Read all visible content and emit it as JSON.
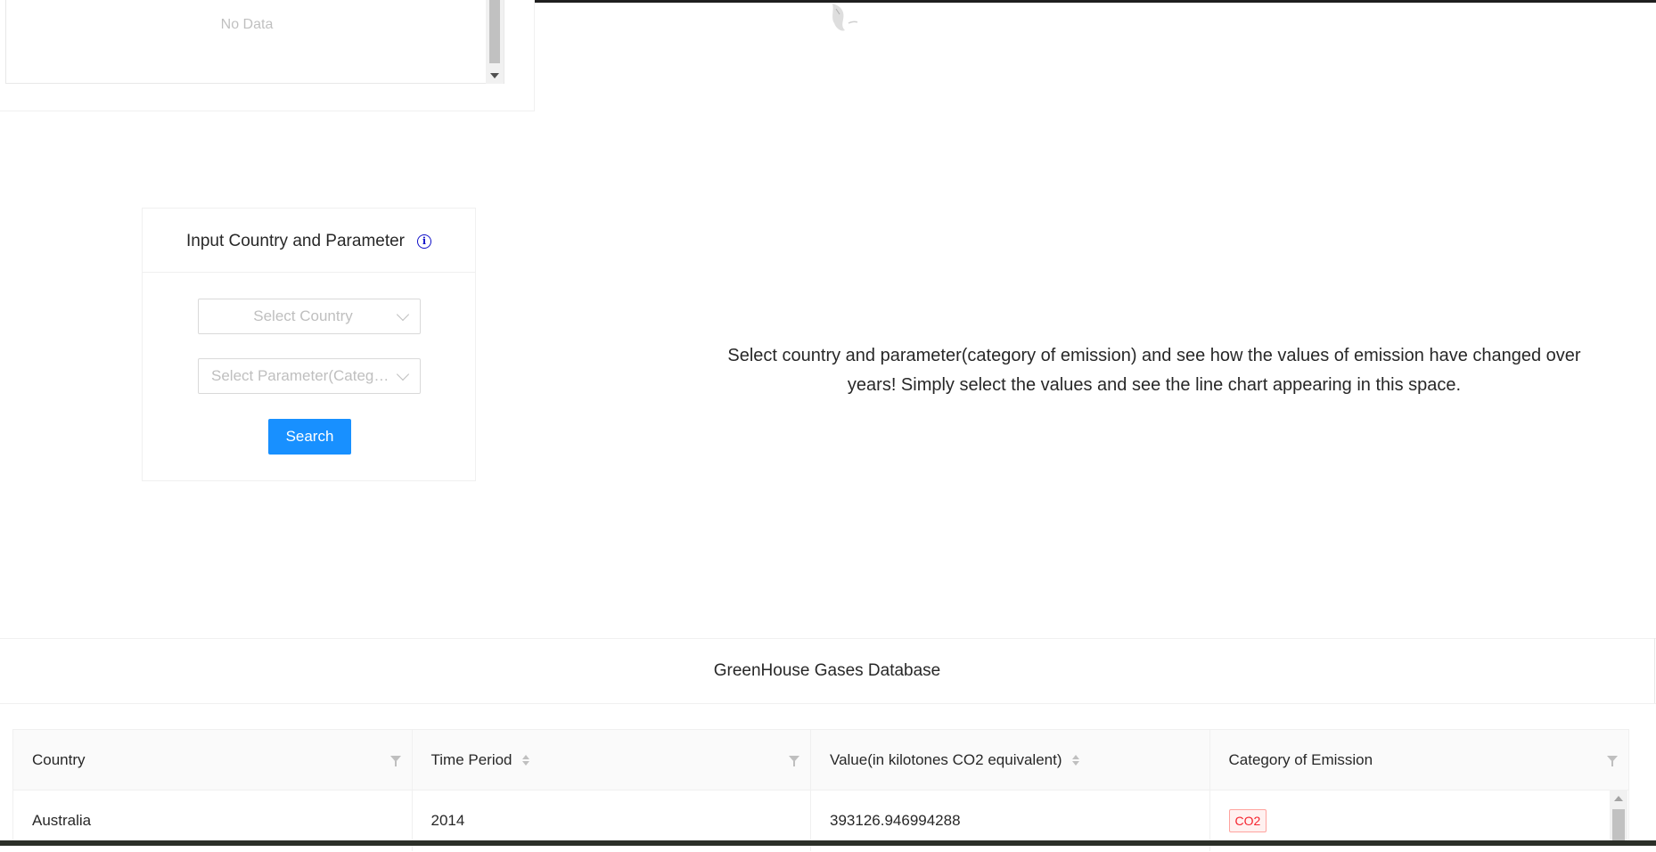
{
  "no_data_panel": {
    "message": "No Data"
  },
  "input_card": {
    "title": "Input Country and Parameter",
    "country_placeholder": "Select Country",
    "parameter_placeholder": "Select Parameter(Category of Emission)",
    "search_label": "Search"
  },
  "hint": {
    "line1": "Select country and parameter(category of emission) and see how the values of emission have changed over",
    "line2": "years! Simply select the values and see the line chart appearing in this space."
  },
  "database": {
    "title": "GreenHouse Gases Database",
    "columns": [
      "Country",
      "Time Period",
      "Value(in kilotones CO2 equivalent)",
      "Category of Emission"
    ],
    "rows": [
      {
        "country": "Australia",
        "time_period": "2014",
        "value": "393126.946994288",
        "category": "CO2"
      }
    ]
  },
  "colors": {
    "primary": "#1890ff",
    "info_icon": "#1010c8",
    "tag_red": "#f5222d"
  },
  "icons": [
    "info-icon",
    "chevron-down-icon",
    "filter-icon",
    "sort-icon"
  ]
}
